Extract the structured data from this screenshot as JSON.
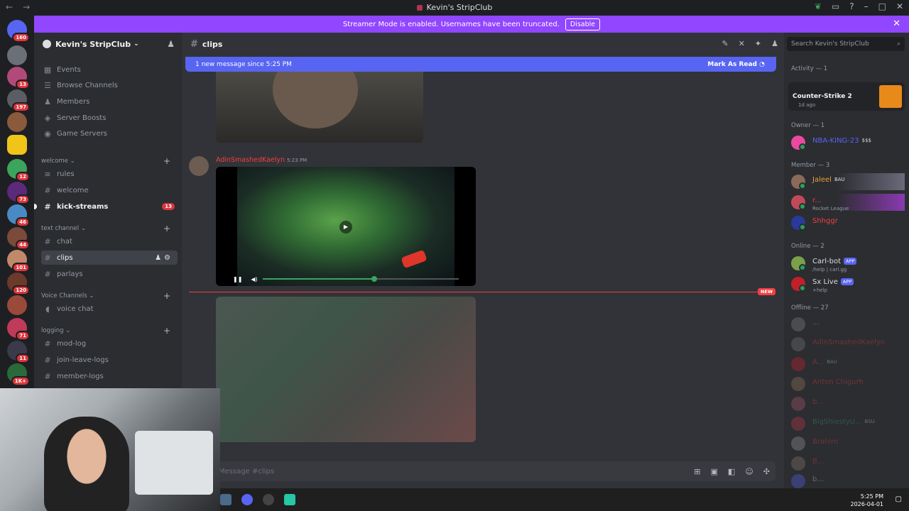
{
  "window": {
    "title": "Kevin's StripClub"
  },
  "rail": {
    "badges": [
      "160",
      "13",
      "197",
      "12",
      "73",
      "46",
      "44",
      "101",
      "120",
      "71",
      "11",
      "1K+"
    ]
  },
  "banner": {
    "text": "Streamer Mode is enabled. Usernames have been truncated.",
    "disable_label": "Disable"
  },
  "sidebar": {
    "server_name": "Kevin's StripClub",
    "top_items": [
      {
        "label": "Events"
      },
      {
        "label": "Browse Channels"
      },
      {
        "label": "Members"
      },
      {
        "label": "Server Boosts"
      },
      {
        "label": "Game Servers"
      }
    ],
    "categories": {
      "welcome": "welcome",
      "text_channel": "text channel",
      "voice": "Voice Channels",
      "logging": "logging"
    },
    "channels": {
      "rules": "rules",
      "welcome": "welcome",
      "kick_streams": "kick-streams",
      "kick_streams_count": "13",
      "chat": "chat",
      "clips": "clips",
      "parlays": "parlays",
      "voice_chat": "voice chat",
      "mod_log": "mod-log",
      "join_leave_logs": "join-leave-logs",
      "member_logs": "member-logs"
    }
  },
  "main": {
    "channel_name": "clips",
    "new_messages": "1 new message since 5:25 PM",
    "mark_as_read": "Mark As Read",
    "message": {
      "author": "AdinSmashedKaelyn",
      "time": "5:23 PM"
    },
    "new_tag": "NEW",
    "composer_placeholder": "Message #clips",
    "video_progress": 0.57
  },
  "members": {
    "search_placeholder": "Search Kevin's StripClub",
    "activity_header": "Activity — 1",
    "activity_game": "Counter-Strike 2",
    "activity_ago": "1d ago",
    "owner_header": "Owner — 1",
    "owner": {
      "name": "NBA-KING-23",
      "tag": "$$$"
    },
    "member_header": "Member — 3",
    "member_list": [
      {
        "name": "Jaleel",
        "tag": "BAU",
        "color": "#e8a23a"
      },
      {
        "name": "r...",
        "sub": "Rocket League",
        "color": "#f23f43"
      },
      {
        "name": "Shhggr",
        "color": "#f23f43"
      }
    ],
    "online_header": "Online — 2",
    "online_list": [
      {
        "name": "Carl-bot",
        "tag": "APP",
        "sub": "/help | carl.gg"
      },
      {
        "name": "Sx Live",
        "tag": "APP",
        "sub": "+help"
      }
    ],
    "offline_header": "Offline — 27",
    "offline_list": [
      {
        "name": "...",
        "color": "#dbdee1"
      },
      {
        "name": "AdinSmashedKaelyn",
        "color": "#f23f43"
      },
      {
        "name": "A...",
        "tag": "BAU",
        "color": "#f23f43"
      },
      {
        "name": "Anton Chigurh",
        "color": "#f23f43"
      },
      {
        "name": "b...",
        "color": "#f23f43"
      },
      {
        "name": "BigShiestyU...",
        "tag": "BSU",
        "color": "#3ba55d"
      },
      {
        "name": "Brahim",
        "color": "#f23f43"
      },
      {
        "name": "B...",
        "color": "#f23f43"
      },
      {
        "name": "b...",
        "color": "#dbdee1"
      }
    ]
  },
  "taskbar": {
    "time": "5:25 PM",
    "date": "2026-04-01"
  },
  "colors": {
    "accent": "#5865f2",
    "streamer_banner": "#9146ff",
    "danger": "#f23f43",
    "online": "#23a55a"
  }
}
